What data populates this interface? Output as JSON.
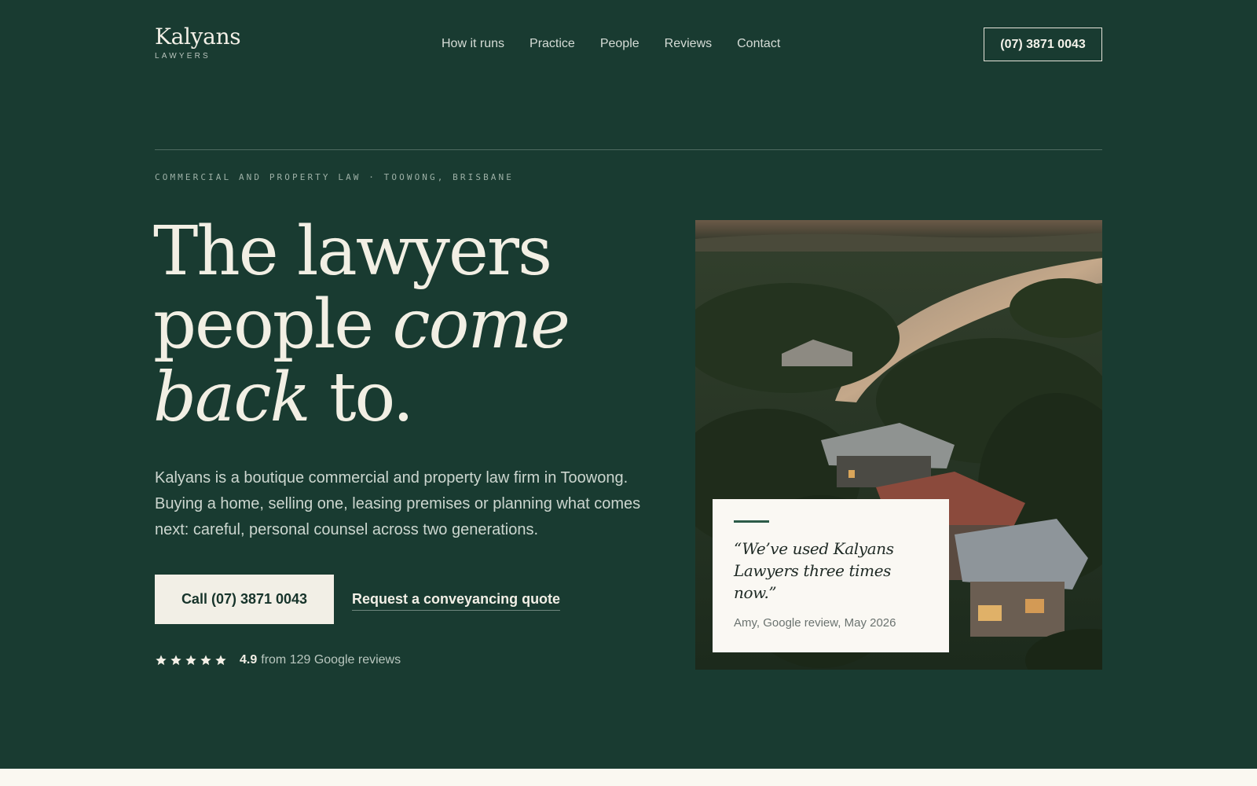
{
  "brand": {
    "name": "Kalyans",
    "tagline": "LAWYERS"
  },
  "nav": {
    "items": [
      "How it runs",
      "Practice",
      "People",
      "Reviews",
      "Contact"
    ],
    "phone_label": "(07) 3871 0043"
  },
  "hero": {
    "eyebrow": "COMMERCIAL AND PROPERTY LAW · TOOWONG, BRISBANE",
    "headline_1": "The lawyers",
    "headline_2": "people ",
    "headline_italic": "come back",
    "headline_3": " to.",
    "lede": "Kalyans is a boutique commercial and property law firm in Toowong. Buying a home, selling one, leasing premises or planning what comes next: careful, personal counsel across two generations.",
    "cta_primary": "Call (07) 3871 0043",
    "cta_secondary": "Request a conveyancing quote",
    "rating": {
      "stars": 5,
      "score": "4.9",
      "text": "from 129 Google reviews"
    }
  },
  "testimonial": {
    "quote": "“We’ve used Kalyans Lawyers three times now.”",
    "cite": "Amy, Google review, May 2026"
  },
  "colors": {
    "background": "#193b31",
    "cream": "#f2efe6",
    "accent": "#2c5b48"
  }
}
